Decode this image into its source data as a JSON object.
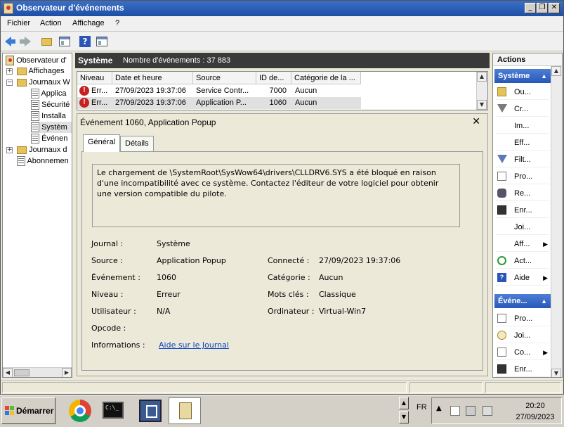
{
  "window": {
    "title": "Observateur d'événements",
    "controls": [
      "_",
      "❐",
      "✕"
    ]
  },
  "menu": [
    "Fichier",
    "Action",
    "Affichage",
    "?"
  ],
  "tree": {
    "root": "Observateur d'",
    "items": [
      {
        "label": "Affichages",
        "indent": 1
      },
      {
        "label": "Journaux W",
        "indent": 1
      },
      {
        "label": "Applica",
        "indent": 2
      },
      {
        "label": "Sécurité",
        "indent": 2
      },
      {
        "label": "Installa",
        "indent": 2
      },
      {
        "label": "Systèm",
        "indent": 2
      },
      {
        "label": "Événen",
        "indent": 2
      },
      {
        "label": "Journaux d",
        "indent": 1
      },
      {
        "label": "Abonnemen",
        "indent": 1
      }
    ]
  },
  "center": {
    "log_name": "Système",
    "event_count": "Nombre d'événements : 37 883",
    "columns": [
      "Niveau",
      "Date et heure",
      "Source",
      "ID de...",
      "Catégorie de la ..."
    ],
    "rows": [
      {
        "level": "Err...",
        "datetime": "27/09/2023 19:37:06",
        "source": "Service Contr...",
        "id": "7000",
        "category": "Aucun"
      },
      {
        "level": "Err...",
        "datetime": "27/09/2023 19:37:06",
        "source": "Application P...",
        "id": "1060",
        "category": "Aucun"
      }
    ]
  },
  "detail": {
    "title": "Événement 1060, Application Popup",
    "tabs": [
      "Général",
      "Détails"
    ],
    "message": "Le chargement de \\SystemRoot\\SysWow64\\drivers\\CLLDRV6.SYS a été bloqué en raison d'une incompatibilité avec ce système. Contactez l'éditeur de votre logiciel pour obtenir une version compatible du pilote.",
    "fields": {
      "journal_label": "Journal :",
      "journal": "Système",
      "source_label": "Source :",
      "source": "Application Popup",
      "event_label": "Événement :",
      "event": "1060",
      "level_label": "Niveau :",
      "level": "Erreur",
      "user_label": "Utilisateur :",
      "user": "N/A",
      "opcode_label": "Opcode :",
      "info_label": "Informations :",
      "info_link": "Aide sur le Journal",
      "logged_label": "Connecté :",
      "logged": "27/09/2023 19:37:06",
      "category_label": "Catégorie :",
      "category": "Aucun",
      "keywords_label": "Mots clés :",
      "keywords": "Classique",
      "computer_label": "Ordinateur :",
      "computer": "Virtual-Win7"
    }
  },
  "actions": {
    "title": "Actions",
    "group1": "Système",
    "group1_items": [
      "Ou...",
      "Cr...",
      "Im...",
      "Eff...",
      "Filt...",
      "Pro...",
      "Re...",
      "Enr...",
      "Joi...",
      "Aff...",
      "Act...",
      "Aide"
    ],
    "group2": "Événe...",
    "group2_items": [
      "Pro...",
      "Joi...",
      "Co...",
      "Enr..."
    ]
  },
  "taskbar": {
    "start": "Démarrer",
    "lang": "FR",
    "time": "20:20",
    "date": "27/09/2023",
    "cmd_text": "C:\\_"
  },
  "colors": {
    "title_bar": "#2a5cb8",
    "action_group": "#3b6cc9",
    "error": "#c82020",
    "link": "#0b44c4"
  }
}
